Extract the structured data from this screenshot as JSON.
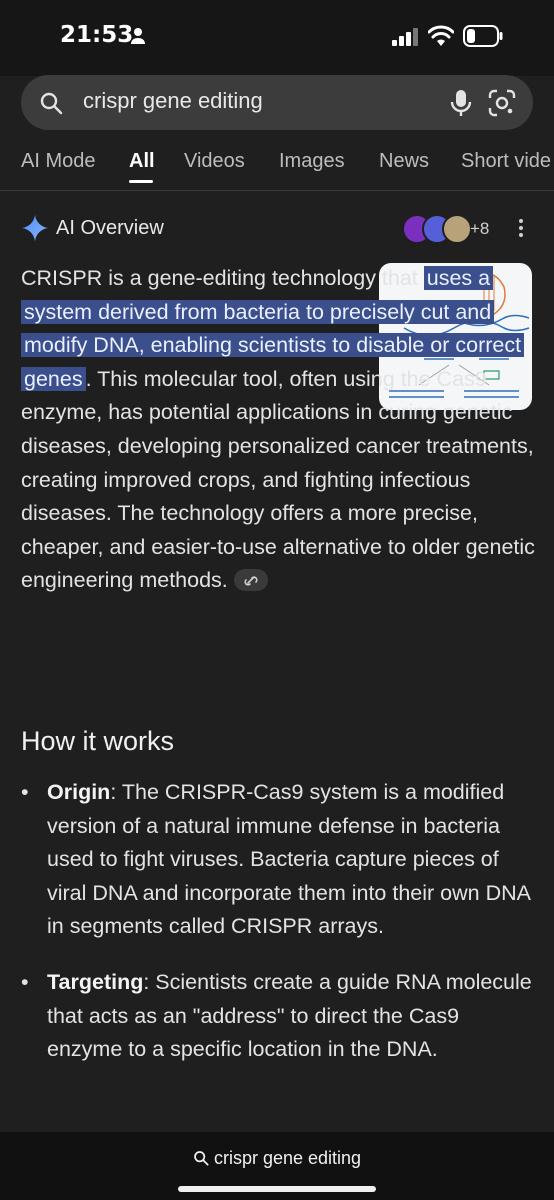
{
  "status": {
    "time": "21:53"
  },
  "search": {
    "query": "crispr gene editing"
  },
  "tabs": [
    {
      "label": "AI Mode"
    },
    {
      "label": "All"
    },
    {
      "label": "Videos"
    },
    {
      "label": "Images"
    },
    {
      "label": "News"
    },
    {
      "label": "Short vide"
    }
  ],
  "ai_overview": {
    "title": "AI Overview",
    "source_count": "+8",
    "intro_plain_1": "CRISPR is a gene-editing technology that ",
    "intro_hl_1": "uses a system derived from bacteria to precisely cut and modify DNA, enabling scientists to disable or correct genes",
    "intro_plain_2": ". This molecular tool, often using the Cas9 enzyme, has potential applications in curing genetic diseases, developing personalized cancer treatments, creating improved crops, and fighting infectious diseases. The technology offers a more precise, cheaper, and easier-to-use alternative to older genetic engineering methods."
  },
  "how_it_works": {
    "heading": "How it works",
    "items": [
      {
        "term": "Origin",
        "text": ": The CRISPR-Cas9 system is a modified version of a natural immune defense in bacteria used to fight viruses. Bacteria capture pieces of viral DNA and incorporate them into their own DNA in segments called CRISPR arrays."
      },
      {
        "term": "Targeting",
        "text": ": Scientists create a guide RNA molecule that acts as an \"address\" to direct the Cas9 enzyme to a specific location in the DNA."
      }
    ]
  },
  "bottom": {
    "query": "crispr gene editing"
  },
  "colors": {
    "background": "#1f1f1f",
    "highlight": "#3b4f8c",
    "search_bar": "#3c3c3c"
  }
}
